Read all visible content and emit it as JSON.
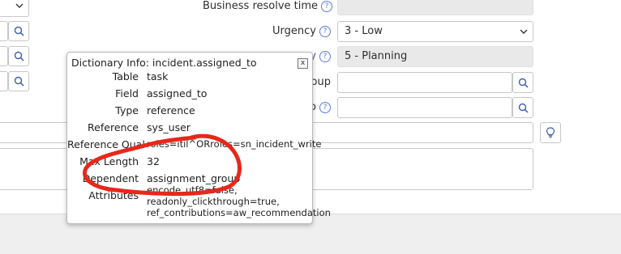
{
  "form": {
    "business_resolve_time_label": "Business resolve time",
    "urgency_label": "Urgency",
    "urgency_value": "3 - Low",
    "priority_label_partial": "y",
    "priority_value": "5 - Planning",
    "assignment_group_label_partial": "roup",
    "assigned_to_label_partial": "o"
  },
  "popup": {
    "title": "Dictionary Info: incident.assigned_to",
    "close_label": "x",
    "rows": [
      {
        "key": "Table",
        "value": "task"
      },
      {
        "key": "Field",
        "value": "assigned_to"
      },
      {
        "key": "Type",
        "value": "reference"
      },
      {
        "key": "Reference",
        "value": "sys_user"
      },
      {
        "key": "Reference Qual",
        "value": "roles=itil^ORroles=sn_incident_write"
      },
      {
        "key": "Max Length",
        "value": "32"
      },
      {
        "key": "Dependent",
        "value": "assignment_group"
      },
      {
        "key": "Attributes",
        "value_lines": [
          "encode_utf8=false,",
          "readonly_clickthrough=true,",
          "ref_contributions=aw_recommendation"
        ]
      }
    ]
  },
  "colors": {
    "annotation_red": "#e8271b",
    "help_icon_blue": "#5b7bd6",
    "readonly_bg": "#e9e9e9"
  }
}
